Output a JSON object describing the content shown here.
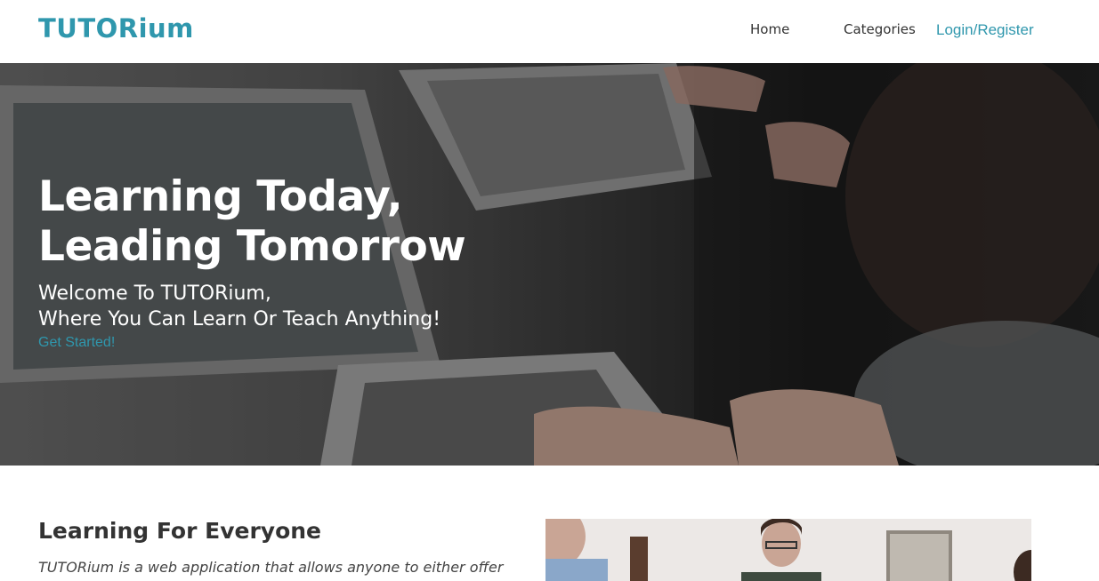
{
  "header": {
    "logo": "TUTORium",
    "nav": {
      "home": "Home",
      "categories": "Categories",
      "login": "Login/Register"
    }
  },
  "hero": {
    "title_line1": "Learning Today,",
    "title_line2": "Leading Tomorrow",
    "subtitle_line1": "Welcome To TUTORium,",
    "subtitle_line2": "Where You Can Learn Or Teach Anything!",
    "cta": "Get Started!"
  },
  "about": {
    "title": "Learning For Everyone",
    "text": "TUTORium is a web application that allows anyone to either offer teaching classes or request a class in any field!"
  },
  "colors": {
    "accent": "#2f97ad",
    "text": "#333333"
  }
}
